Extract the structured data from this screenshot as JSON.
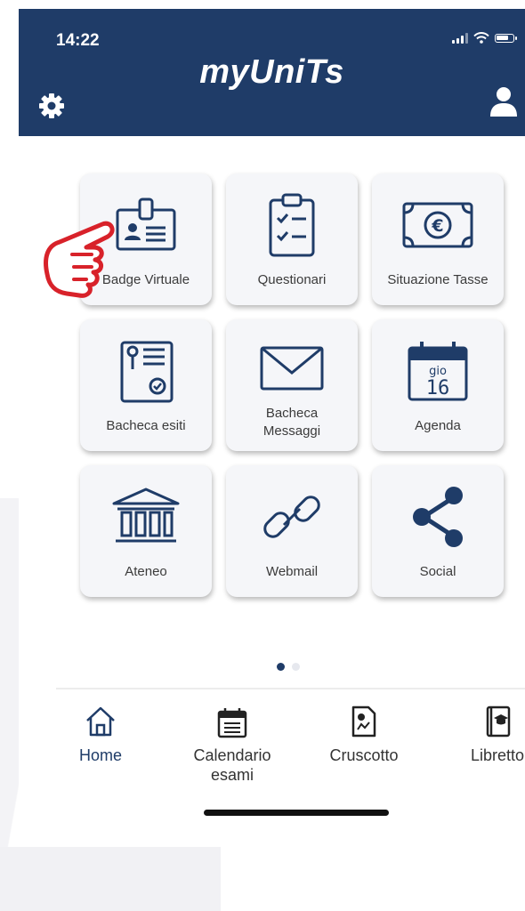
{
  "status": {
    "time": "14:22"
  },
  "header": {
    "title": "myUniTs"
  },
  "tiles": [
    {
      "label": "Badge Virtuale",
      "icon": "id-badge-icon"
    },
    {
      "label": "Questionari",
      "icon": "clipboard-checklist-icon"
    },
    {
      "label": "Situazione Tasse",
      "icon": "euro-banknote-icon"
    },
    {
      "label": "Bacheca esiti",
      "icon": "certificate-icon"
    },
    {
      "label_line1": "Bacheca",
      "label_line2": "Messaggi",
      "icon": "envelope-icon"
    },
    {
      "label": "Agenda",
      "icon": "calendar-icon",
      "calendar_day": "gio",
      "calendar_date": "16"
    },
    {
      "label": "Ateneo",
      "icon": "university-building-icon"
    },
    {
      "label": "Webmail",
      "icon": "link-icon"
    },
    {
      "label": "Social",
      "icon": "share-icon"
    }
  ],
  "pager": {
    "current": 1,
    "total": 2
  },
  "tabbar": [
    {
      "label": "Home",
      "icon": "home-icon",
      "active": true
    },
    {
      "label_line1": "Calendario",
      "label_line2": "esami",
      "icon": "calendar-list-icon"
    },
    {
      "label": "Cruscotto",
      "icon": "document-chart-icon"
    },
    {
      "label": "Libretto",
      "icon": "grad-book-icon"
    }
  ],
  "colors": {
    "header_bg": "#1f3c68",
    "accent_red": "#d8222a",
    "tile_bg": "#f5f6f9"
  }
}
